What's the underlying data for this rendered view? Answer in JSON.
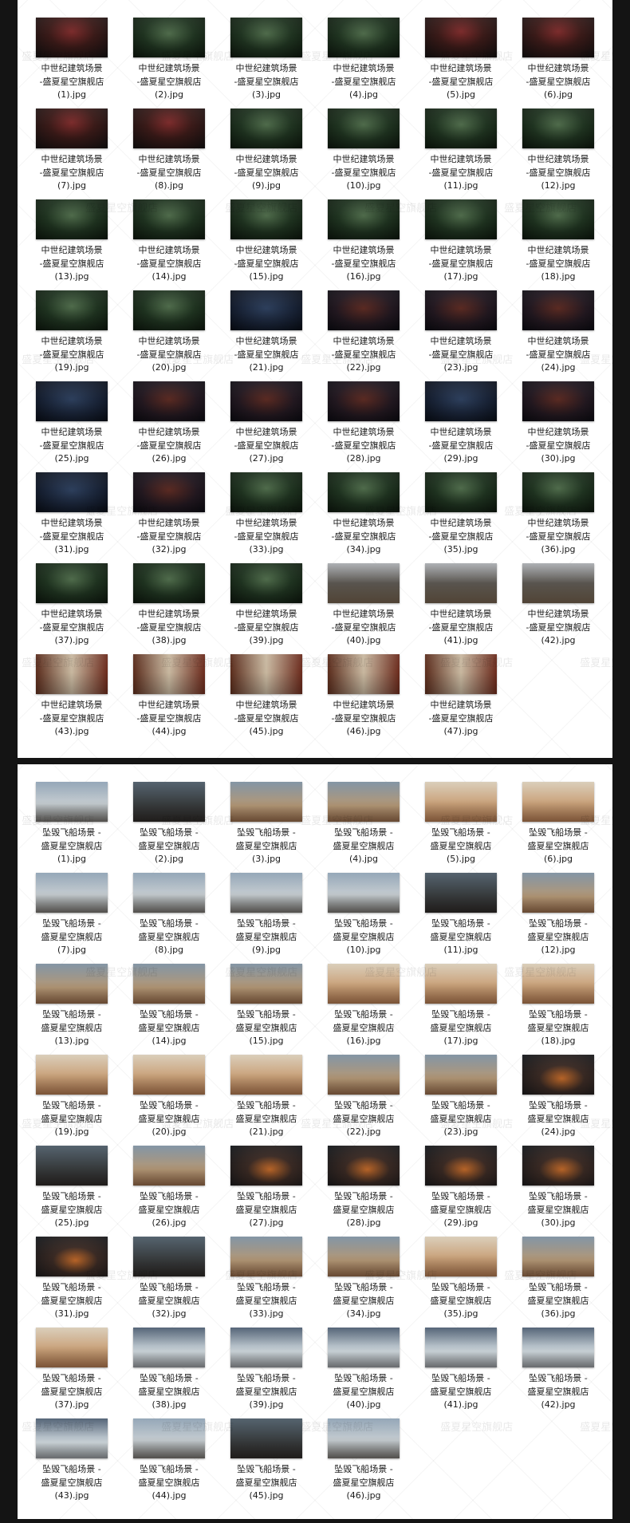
{
  "watermark": "盛夏星空旗舰店",
  "panels": [
    {
      "name": "medieval-architecture-panel",
      "items": [
        {
          "line1": "中世纪建筑场景",
          "line2": "-盛夏星空旗舰店",
          "line3": "(1).jpg",
          "scene": "temple"
        },
        {
          "line1": "中世纪建筑场景",
          "line2": "-盛夏星空旗舰店",
          "line3": "(2).jpg",
          "scene": "forest"
        },
        {
          "line1": "中世纪建筑场景",
          "line2": "-盛夏星空旗舰店",
          "line3": "(3).jpg",
          "scene": "forest"
        },
        {
          "line1": "中世纪建筑场景",
          "line2": "-盛夏星空旗舰店",
          "line3": "(4).jpg",
          "scene": "forest"
        },
        {
          "line1": "中世纪建筑场景",
          "line2": "-盛夏星空旗舰店",
          "line3": "(5).jpg",
          "scene": "temple"
        },
        {
          "line1": "中世纪建筑场景",
          "line2": "-盛夏星空旗舰店",
          "line3": "(6).jpg",
          "scene": "temple"
        },
        {
          "line1": "中世纪建筑场景",
          "line2": "-盛夏星空旗舰店",
          "line3": "(7).jpg",
          "scene": "temple"
        },
        {
          "line1": "中世纪建筑场景",
          "line2": "-盛夏星空旗舰店",
          "line3": "(8).jpg",
          "scene": "temple"
        },
        {
          "line1": "中世纪建筑场景",
          "line2": "-盛夏星空旗舰店",
          "line3": "(9).jpg",
          "scene": "forest"
        },
        {
          "line1": "中世纪建筑场景",
          "line2": "-盛夏星空旗舰店",
          "line3": "(10).jpg",
          "scene": "forest"
        },
        {
          "line1": "中世纪建筑场景",
          "line2": "-盛夏星空旗舰店",
          "line3": "(11).jpg",
          "scene": "forest"
        },
        {
          "line1": "中世纪建筑场景",
          "line2": "-盛夏星空旗舰店",
          "line3": "(12).jpg",
          "scene": "forest"
        },
        {
          "line1": "中世纪建筑场景",
          "line2": "-盛夏星空旗舰店",
          "line3": "(13).jpg",
          "scene": "forest"
        },
        {
          "line1": "中世纪建筑场景",
          "line2": "-盛夏星空旗舰店",
          "line3": "(14).jpg",
          "scene": "forest"
        },
        {
          "line1": "中世纪建筑场景",
          "line2": "-盛夏星空旗舰店",
          "line3": "(15).jpg",
          "scene": "forest"
        },
        {
          "line1": "中世纪建筑场景",
          "line2": "-盛夏星空旗舰店",
          "line3": "(16).jpg",
          "scene": "forest"
        },
        {
          "line1": "中世纪建筑场景",
          "line2": "-盛夏星空旗舰店",
          "line3": "(17).jpg",
          "scene": "forest"
        },
        {
          "line1": "中世纪建筑场景",
          "line2": "-盛夏星空旗舰店",
          "line3": "(18).jpg",
          "scene": "forest"
        },
        {
          "line1": "中世纪建筑场景",
          "line2": "-盛夏星空旗舰店",
          "line3": "(19).jpg",
          "scene": "forest"
        },
        {
          "line1": "中世纪建筑场景",
          "line2": "-盛夏星空旗舰店",
          "line3": "(20).jpg",
          "scene": "forest"
        },
        {
          "line1": "中世纪建筑场景",
          "line2": "-盛夏星空旗舰店",
          "line3": "(21).jpg",
          "scene": "night"
        },
        {
          "line1": "中世纪建筑场景",
          "line2": "-盛夏星空旗舰店",
          "line3": "(22).jpg",
          "scene": "lantern"
        },
        {
          "line1": "中世纪建筑场景",
          "line2": "-盛夏星空旗舰店",
          "line3": "(23).jpg",
          "scene": "lantern"
        },
        {
          "line1": "中世纪建筑场景",
          "line2": "-盛夏星空旗舰店",
          "line3": "(24).jpg",
          "scene": "lantern"
        },
        {
          "line1": "中世纪建筑场景",
          "line2": "-盛夏星空旗舰店",
          "line3": "(25).jpg",
          "scene": "night"
        },
        {
          "line1": "中世纪建筑场景",
          "line2": "-盛夏星空旗舰店",
          "line3": "(26).jpg",
          "scene": "lantern"
        },
        {
          "line1": "中世纪建筑场景",
          "line2": "-盛夏星空旗舰店",
          "line3": "(27).jpg",
          "scene": "lantern"
        },
        {
          "line1": "中世纪建筑场景",
          "line2": "-盛夏星空旗舰店",
          "line3": "(28).jpg",
          "scene": "lantern"
        },
        {
          "line1": "中世纪建筑场景",
          "line2": "-盛夏星空旗舰店",
          "line3": "(29).jpg",
          "scene": "night"
        },
        {
          "line1": "中世纪建筑场景",
          "line2": "-盛夏星空旗舰店",
          "line3": "(30).jpg",
          "scene": "lantern"
        },
        {
          "line1": "中世纪建筑场景",
          "line2": "-盛夏星空旗舰店",
          "line3": "(31).jpg",
          "scene": "night"
        },
        {
          "line1": "中世纪建筑场景",
          "line2": "-盛夏星空旗舰店",
          "line3": "(32).jpg",
          "scene": "lantern"
        },
        {
          "line1": "中世纪建筑场景",
          "line2": "-盛夏星空旗舰店",
          "line3": "(33).jpg",
          "scene": "forest"
        },
        {
          "line1": "中世纪建筑场景",
          "line2": "-盛夏星空旗舰店",
          "line3": "(34).jpg",
          "scene": "forest"
        },
        {
          "line1": "中世纪建筑场景",
          "line2": "-盛夏星空旗舰店",
          "line3": "(35).jpg",
          "scene": "forest"
        },
        {
          "line1": "中世纪建筑场景",
          "line2": "-盛夏星空旗舰店",
          "line3": "(36).jpg",
          "scene": "forest"
        },
        {
          "line1": "中世纪建筑场景",
          "line2": "-盛夏星空旗舰店",
          "line3": "(37).jpg",
          "scene": "forest"
        },
        {
          "line1": "中世纪建筑场景",
          "line2": "-盛夏星空旗舰店",
          "line3": "(38).jpg",
          "scene": "forest"
        },
        {
          "line1": "中世纪建筑场景",
          "line2": "-盛夏星空旗舰店",
          "line3": "(39).jpg",
          "scene": "forest"
        },
        {
          "line1": "中世纪建筑场景",
          "line2": "-盛夏星空旗舰店",
          "line3": "(40).jpg",
          "scene": "court"
        },
        {
          "line1": "中世纪建筑场景",
          "line2": "-盛夏星空旗舰店",
          "line3": "(41).jpg",
          "scene": "court"
        },
        {
          "line1": "中世纪建筑场景",
          "line2": "-盛夏星空旗舰店",
          "line3": "(42).jpg",
          "scene": "court"
        },
        {
          "line1": "中世纪建筑场景",
          "line2": "-盛夏星空旗舰店",
          "line3": "(43).jpg",
          "scene": "street"
        },
        {
          "line1": "中世纪建筑场景",
          "line2": "-盛夏星空旗舰店",
          "line3": "(44).jpg",
          "scene": "street"
        },
        {
          "line1": "中世纪建筑场景",
          "line2": "-盛夏星空旗舰店",
          "line3": "(45).jpg",
          "scene": "street"
        },
        {
          "line1": "中世纪建筑场景",
          "line2": "-盛夏星空旗舰店",
          "line3": "(46).jpg",
          "scene": "street"
        },
        {
          "line1": "中世纪建筑场景",
          "line2": "-盛夏星空旗舰店",
          "line3": "(47).jpg",
          "scene": "street"
        }
      ]
    },
    {
      "name": "crashed-spaceship-panel",
      "items": [
        {
          "line1": "坠毁飞船场景 -",
          "line2": "盛夏星空旗舰店",
          "line3": "(1).jpg",
          "scene": "snowy"
        },
        {
          "line1": "坠毁飞船场景 -",
          "line2": "盛夏星空旗舰店",
          "line3": "(2).jpg",
          "scene": "dark"
        },
        {
          "line1": "坠毁飞船场景 -",
          "line2": "盛夏星空旗舰店",
          "line3": "(3).jpg",
          "scene": "cloudy"
        },
        {
          "line1": "坠毁飞船场景 -",
          "line2": "盛夏星空旗舰店",
          "line3": "(4).jpg",
          "scene": "cloudy"
        },
        {
          "line1": "坠毁飞船场景 -",
          "line2": "盛夏星空旗舰店",
          "line3": "(5).jpg",
          "scene": "desert"
        },
        {
          "line1": "坠毁飞船场景 -",
          "line2": "盛夏星空旗舰店",
          "line3": "(6).jpg",
          "scene": "desert"
        },
        {
          "line1": "坠毁飞船场景 -",
          "line2": "盛夏星空旗舰店",
          "line3": "(7).jpg",
          "scene": "snowy"
        },
        {
          "line1": "坠毁飞船场景 -",
          "line2": "盛夏星空旗舰店",
          "line3": "(8).jpg",
          "scene": "snowy"
        },
        {
          "line1": "坠毁飞船场景 -",
          "line2": "盛夏星空旗舰店",
          "line3": "(9).jpg",
          "scene": "snowy"
        },
        {
          "line1": "坠毁飞船场景 -",
          "line2": "盛夏星空旗舰店",
          "line3": "(10).jpg",
          "scene": "snowy"
        },
        {
          "line1": "坠毁飞船场景 -",
          "line2": "盛夏星空旗舰店",
          "line3": "(11).jpg",
          "scene": "dark"
        },
        {
          "line1": "坠毁飞船场景 -",
          "line2": "盛夏星空旗舰店",
          "line3": "(12).jpg",
          "scene": "cloudy"
        },
        {
          "line1": "坠毁飞船场景 -",
          "line2": "盛夏星空旗舰店",
          "line3": "(13).jpg",
          "scene": "cloudy"
        },
        {
          "line1": "坠毁飞船场景 -",
          "line2": "盛夏星空旗舰店",
          "line3": "(14).jpg",
          "scene": "cloudy"
        },
        {
          "line1": "坠毁飞船场景 -",
          "line2": "盛夏星空旗舰店",
          "line3": "(15).jpg",
          "scene": "cloudy"
        },
        {
          "line1": "坠毁飞船场景 -",
          "line2": "盛夏星空旗舰店",
          "line3": "(16).jpg",
          "scene": "desert"
        },
        {
          "line1": "坠毁飞船场景 -",
          "line2": "盛夏星空旗舰店",
          "line3": "(17).jpg",
          "scene": "desert"
        },
        {
          "line1": "坠毁飞船场景 -",
          "line2": "盛夏星空旗舰店",
          "line3": "(18).jpg",
          "scene": "desert"
        },
        {
          "line1": "坠毁飞船场景 -",
          "line2": "盛夏星空旗舰店",
          "line3": "(19).jpg",
          "scene": "desert"
        },
        {
          "line1": "坠毁飞船场景 -",
          "line2": "盛夏星空旗舰店",
          "line3": "(20).jpg",
          "scene": "desert"
        },
        {
          "line1": "坠毁飞船场景 -",
          "line2": "盛夏星空旗舰店",
          "line3": "(21).jpg",
          "scene": "desert"
        },
        {
          "line1": "坠毁飞船场景 -",
          "line2": "盛夏星空旗舰店",
          "line3": "(22).jpg",
          "scene": "cloudy"
        },
        {
          "line1": "坠毁飞船场景 -",
          "line2": "盛夏星空旗舰店",
          "line3": "(23).jpg",
          "scene": "cloudy"
        },
        {
          "line1": "坠毁飞船场景 -",
          "line2": "盛夏星空旗舰店",
          "line3": "(24).jpg",
          "scene": "fire"
        },
        {
          "line1": "坠毁飞船场景 -",
          "line2": "盛夏星空旗舰店",
          "line3": "(25).jpg",
          "scene": "dark"
        },
        {
          "line1": "坠毁飞船场景 -",
          "line2": "盛夏星空旗舰店",
          "line3": "(26).jpg",
          "scene": "cloudy"
        },
        {
          "line1": "坠毁飞船场景 -",
          "line2": "盛夏星空旗舰店",
          "line3": "(27).jpg",
          "scene": "fire"
        },
        {
          "line1": "坠毁飞船场景 -",
          "line2": "盛夏星空旗舰店",
          "line3": "(28).jpg",
          "scene": "fire"
        },
        {
          "line1": "坠毁飞船场景 -",
          "line2": "盛夏星空旗舰店",
          "line3": "(29).jpg",
          "scene": "fire"
        },
        {
          "line1": "坠毁飞船场景 -",
          "line2": "盛夏星空旗舰店",
          "line3": "(30).jpg",
          "scene": "fire"
        },
        {
          "line1": "坠毁飞船场景 -",
          "line2": "盛夏星空旗舰店",
          "line3": "(31).jpg",
          "scene": "fire"
        },
        {
          "line1": "坠毁飞船场景 -",
          "line2": "盛夏星空旗舰店",
          "line3": "(32).jpg",
          "scene": "dark"
        },
        {
          "line1": "坠毁飞船场景 -",
          "line2": "盛夏星空旗舰店",
          "line3": "(33).jpg",
          "scene": "cloudy"
        },
        {
          "line1": "坠毁飞船场景 -",
          "line2": "盛夏星空旗舰店",
          "line3": "(34).jpg",
          "scene": "cloudy"
        },
        {
          "line1": "坠毁飞船场景 -",
          "line2": "盛夏星空旗舰店",
          "line3": "(35).jpg",
          "scene": "desert"
        },
        {
          "line1": "坠毁飞船场景 -",
          "line2": "盛夏星空旗舰店",
          "line3": "(36).jpg",
          "scene": "cloudy"
        },
        {
          "line1": "坠毁飞船场景 -",
          "line2": "盛夏星空旗舰店",
          "line3": "(37).jpg",
          "scene": "desert"
        },
        {
          "line1": "坠毁飞船场景 -",
          "line2": "盛夏星空旗舰店",
          "line3": "(38).jpg",
          "scene": "ice"
        },
        {
          "line1": "坠毁飞船场景 -",
          "line2": "盛夏星空旗舰店",
          "line3": "(39).jpg",
          "scene": "ice"
        },
        {
          "line1": "坠毁飞船场景 -",
          "line2": "盛夏星空旗舰店",
          "line3": "(40).jpg",
          "scene": "ice"
        },
        {
          "line1": "坠毁飞船场景 -",
          "line2": "盛夏星空旗舰店",
          "line3": "(41).jpg",
          "scene": "ice"
        },
        {
          "line1": "坠毁飞船场景 -",
          "line2": "盛夏星空旗舰店",
          "line3": "(42).jpg",
          "scene": "ice"
        },
        {
          "line1": "坠毁飞船场景 -",
          "line2": "盛夏星空旗舰店",
          "line3": "(43).jpg",
          "scene": "ice"
        },
        {
          "line1": "坠毁飞船场景 -",
          "line2": "盛夏星空旗舰店",
          "line3": "(44).jpg",
          "scene": "snowy"
        },
        {
          "line1": "坠毁飞船场景 -",
          "line2": "盛夏星空旗舰店",
          "line3": "(45).jpg",
          "scene": "dark"
        },
        {
          "line1": "坠毁飞船场景 -",
          "line2": "盛夏星空旗舰店",
          "line3": "(46).jpg",
          "scene": "snowy"
        }
      ]
    }
  ]
}
